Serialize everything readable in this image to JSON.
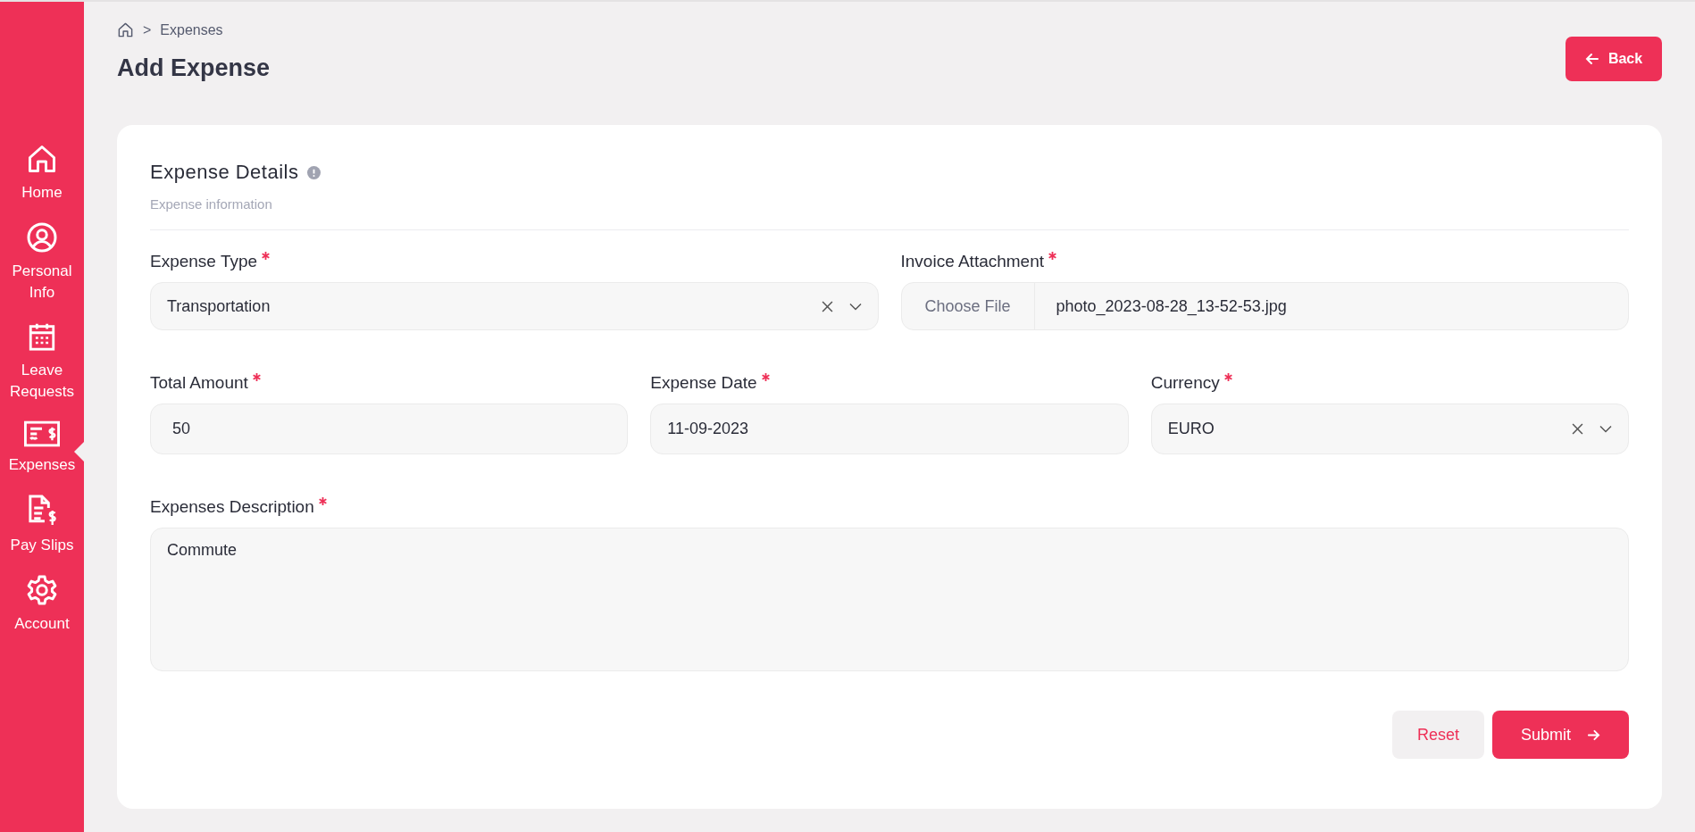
{
  "sidebar": {
    "items": [
      {
        "label": "Home",
        "selected": false
      },
      {
        "label": "Personal Info",
        "selected": false
      },
      {
        "label": "Leave Requests",
        "selected": false
      },
      {
        "label": "Expenses",
        "selected": true
      },
      {
        "label": "Pay Slips",
        "selected": false
      },
      {
        "label": "Account",
        "selected": false
      }
    ]
  },
  "breadcrumb": {
    "separator": ">",
    "items": [
      "Expenses"
    ]
  },
  "page_title": "Add Expense",
  "back_button": {
    "label": "Back"
  },
  "card": {
    "title": "Expense Details",
    "subtitle": "Expense information",
    "fields": [
      {
        "kind": "select",
        "label": "Expense Type",
        "required": true,
        "value": "Transportation"
      },
      {
        "kind": "file",
        "label": "Invoice Attachment",
        "required": true,
        "button": "Choose File",
        "value": "photo_2023-08-28_13-52-53.jpg"
      },
      {
        "kind": "text",
        "label": "Total Amount",
        "required": true,
        "value": "50"
      },
      {
        "kind": "text",
        "label": "Expense Date",
        "required": true,
        "value": "11-09-2023"
      },
      {
        "kind": "select",
        "label": "Currency",
        "required": true,
        "value": "EURO"
      },
      {
        "kind": "textarea",
        "label": "Expenses Description",
        "required": true,
        "value": "Commute"
      }
    ],
    "reset_button": "Reset",
    "submit_button": "Submit"
  }
}
